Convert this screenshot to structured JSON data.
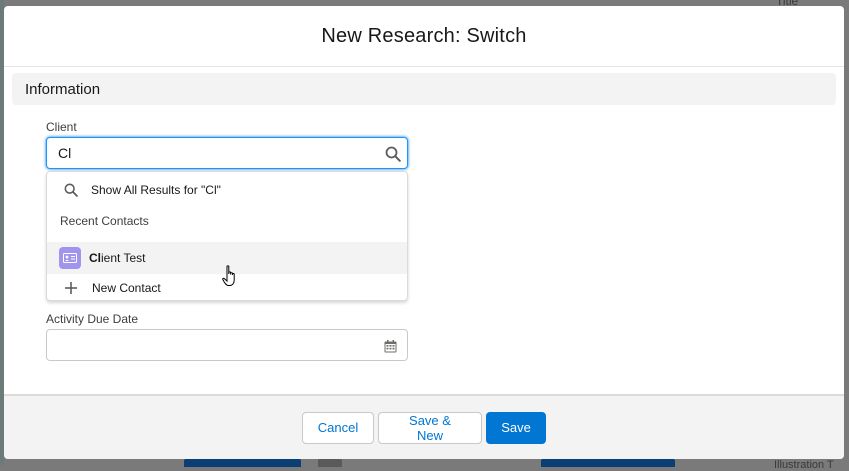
{
  "modal": {
    "title": "New Research: Switch"
  },
  "section": {
    "title": "Information"
  },
  "client_field": {
    "label": "Client",
    "value": "Cl",
    "icon": "search-icon"
  },
  "lookup_dropdown": {
    "show_all_prefix": "Show All Results for \"Cl\"",
    "recent_heading": "Recent Contacts",
    "result": {
      "match": "Cl",
      "rest": "ient Test",
      "icon": "contact-icon"
    },
    "new_contact": "New Contact"
  },
  "due_date_field": {
    "label": "Activity Due Date",
    "value": "",
    "icon": "calendar-icon"
  },
  "footer": {
    "cancel": "Cancel",
    "save_new": "Save & New",
    "save": "Save"
  },
  "background": {
    "top_right_text": "Title",
    "bottom_right_text": "Illustration T"
  },
  "colors": {
    "brand": "#0176d3",
    "contact_icon_bg": "#a094ed",
    "focus_border": "#1b96ff"
  }
}
